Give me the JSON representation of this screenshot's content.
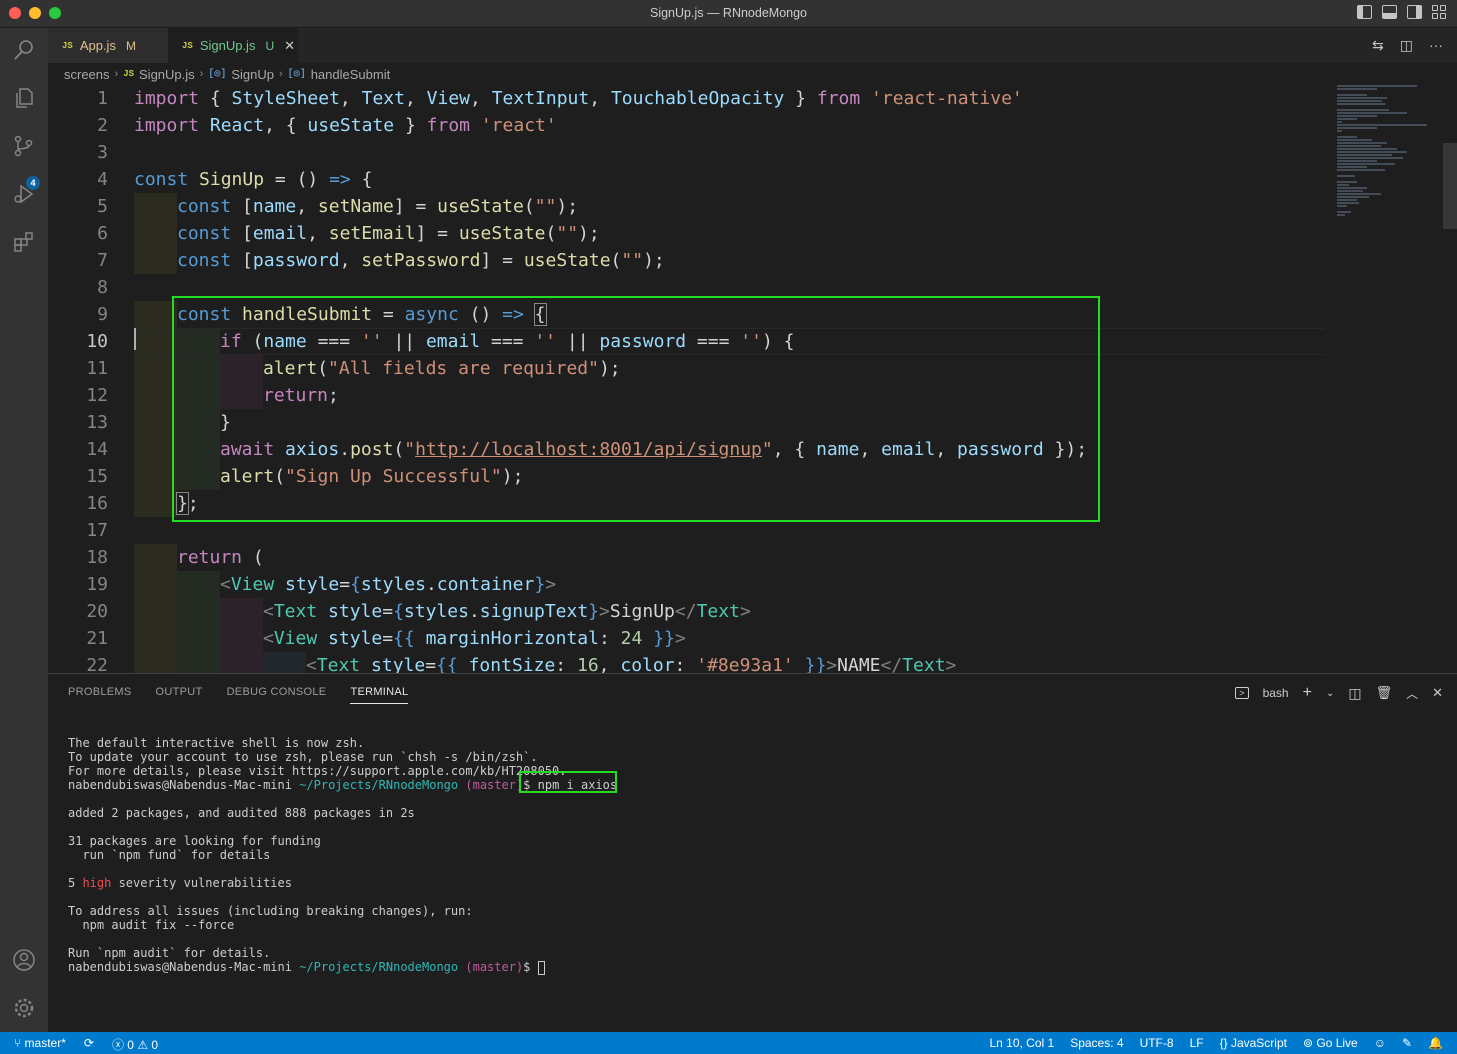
{
  "window": {
    "title": "SignUp.js — RNnodeMongo"
  },
  "activity_bar": {
    "icons": [
      "files-icon",
      "search-icon",
      "source-control-icon",
      "run-debug-icon",
      "extensions-icon",
      "account-icon",
      "gear-icon"
    ],
    "source_control_badge": "4"
  },
  "tabs": [
    {
      "icon": "JS",
      "label": "App.js",
      "status": "M",
      "active": false
    },
    {
      "icon": "JS",
      "label": "SignUp.js",
      "status": "U",
      "active": true
    }
  ],
  "breadcrumb": {
    "folder": "screens",
    "file_icon": "JS",
    "file": "SignUp.js",
    "symbol_icon": "[◎]",
    "symbol1": "SignUp",
    "symbol2": "handleSubmit"
  },
  "editor": {
    "line_numbers": [
      "1",
      "2",
      "3",
      "4",
      "5",
      "6",
      "7",
      "8",
      "9",
      "10",
      "11",
      "12",
      "13",
      "14",
      "15",
      "16",
      "17",
      "18",
      "19",
      "20",
      "21",
      "22"
    ],
    "active_line": "10",
    "code": {
      "l1a": "import",
      "l1b": " { ",
      "l1c": "StyleSheet",
      "l1d": ", ",
      "l1e": "Text",
      "l1f": ", ",
      "l1g": "View",
      "l1h": ", ",
      "l1i": "TextInput",
      "l1j": ", ",
      "l1k": "TouchableOpacity",
      "l1l": " } ",
      "l1m": "from",
      "l1n": " ",
      "l1o": "'react-native'",
      "l2a": "import",
      "l2b": " ",
      "l2c": "React",
      "l2d": ", { ",
      "l2e": "useState",
      "l2f": " } ",
      "l2g": "from",
      "l2h": " ",
      "l2i": "'react'",
      "l4a": "const",
      "l4b": " ",
      "l4c": "SignUp",
      "l4d": " = () ",
      "l4e": "=>",
      "l4f": " {",
      "l5a": "const",
      "l5b": " [",
      "l5c": "name",
      "l5d": ", ",
      "l5e": "setName",
      "l5f": "] = ",
      "l5g": "useState",
      "l5h": "(",
      "l5i": "\"\"",
      "l5j": ");",
      "l6a": "const",
      "l6b": " [",
      "l6c": "email",
      "l6d": ", ",
      "l6e": "setEmail",
      "l6f": "] = ",
      "l6g": "useState",
      "l6h": "(",
      "l6i": "\"\"",
      "l6j": ");",
      "l7a": "const",
      "l7b": " [",
      "l7c": "password",
      "l7d": ", ",
      "l7e": "setPassword",
      "l7f": "] = ",
      "l7g": "useState",
      "l7h": "(",
      "l7i": "\"\"",
      "l7j": ");",
      "l9a": "const",
      "l9b": " ",
      "l9c": "handleSubmit",
      "l9d": " = ",
      "l9e": "async",
      "l9f": " () ",
      "l9g": "=>",
      "l9h": " ",
      "l9i": "{",
      "l10a": "if",
      "l10b": " (",
      "l10c": "name",
      "l10d": " === ",
      "l10e": "''",
      "l10f": " || ",
      "l10g": "email",
      "l10h": " === ",
      "l10i": "''",
      "l10j": " || ",
      "l10k": "password",
      "l10l": " === ",
      "l10m": "''",
      "l10n": ") {",
      "l11a": "alert",
      "l11b": "(",
      "l11c": "\"All fields are required\"",
      "l11d": ");",
      "l12a": "return",
      "l12b": ";",
      "l13a": "}",
      "l14a": "await",
      "l14b": " ",
      "l14c": "axios",
      "l14d": ".",
      "l14e": "post",
      "l14f": "(",
      "l14g": "\"",
      "l14h": "http://localhost:8001/api/signup",
      "l14i": "\"",
      "l14j": ", { ",
      "l14k": "name",
      "l14l": ", ",
      "l14m": "email",
      "l14n": ", ",
      "l14o": "password",
      "l14p": " });",
      "l15a": "alert",
      "l15b": "(",
      "l15c": "\"Sign Up Successful\"",
      "l15d": ");",
      "l16a": "}",
      "l16b": ";",
      "l18a": "return",
      "l18b": " (",
      "l19a": "<",
      "l19b": "View",
      "l19c": " ",
      "l19d": "style",
      "l19e": "=",
      "l19f": "{",
      "l19g": "styles",
      "l19h": ".",
      "l19i": "container",
      "l19j": "}",
      "l19k": ">",
      "l20a": "<",
      "l20b": "Text",
      "l20c": " ",
      "l20d": "style",
      "l20e": "=",
      "l20f": "{",
      "l20g": "styles",
      "l20h": ".",
      "l20i": "signupText",
      "l20j": "}",
      "l20k": ">",
      "l20l": "SignUp",
      "l20m": "</",
      "l20n": "Text",
      "l20o": ">",
      "l21a": "<",
      "l21b": "View",
      "l21c": " ",
      "l21d": "style",
      "l21e": "=",
      "l21f": "{{ ",
      "l21g": "marginHorizontal",
      "l21h": ": ",
      "l21i": "24",
      "l21j": " }}",
      "l21k": ">",
      "l22a": "<",
      "l22b": "Text",
      "l22c": " ",
      "l22d": "style",
      "l22e": "=",
      "l22f": "{{ ",
      "l22g": "fontSize",
      "l22h": ": ",
      "l22i": "16",
      "l22j": ", ",
      "l22k": "color",
      "l22l": ": ",
      "l22m": "'#8e93a1'",
      "l22n": " }}",
      "l22o": ">",
      "l22p": "NAME",
      "l22q": "</",
      "l22r": "Text",
      "l22s": ">"
    }
  },
  "panel": {
    "tabs": [
      "PROBLEMS",
      "OUTPUT",
      "DEBUG CONSOLE",
      "TERMINAL"
    ],
    "active_tab": "TERMINAL",
    "shell": "bash",
    "terminal": {
      "l1": "The default interactive shell is now zsh.",
      "l2": "To update your account to use zsh, please run `chsh -s /bin/zsh`.",
      "l3": "For more details, please visit https://support.apple.com/kb/HT208050.",
      "l4_user": "nabendubiswas@Nabendus-Mac-mini ",
      "l4_path": "~/Projects/RNnodeMongo",
      "l4_branch": " (master)",
      "l4_prompt": "$ ",
      "l4_cmd": "npm i axios",
      "l6": "added 2 packages, and audited 888 packages in 2s",
      "l8": "31 packages are looking for funding",
      "l9": "  run `npm fund` for details",
      "l11a": "5 ",
      "l11b": "high",
      "l11c": " severity vulnerabilities",
      "l13": "To address all issues (including breaking changes), run:",
      "l14": "  npm audit fix --force",
      "l16": "Run `npm audit` for details.",
      "l17_user": "nabendubiswas@Nabendus-Mac-mini ",
      "l17_path": "~/Projects/RNnodeMongo",
      "l17_branch": " (master)",
      "l17_prompt": "$ "
    }
  },
  "status_bar": {
    "branch": "master*",
    "errors": "0",
    "warnings": "0",
    "position": "Ln 10, Col 1",
    "spaces": "Spaces: 4",
    "encoding": "UTF-8",
    "eol": "LF",
    "language": "JavaScript",
    "golive": "Go Live"
  },
  "colors": {
    "accent": "#007acc",
    "highlight_box": "#22dd22"
  }
}
